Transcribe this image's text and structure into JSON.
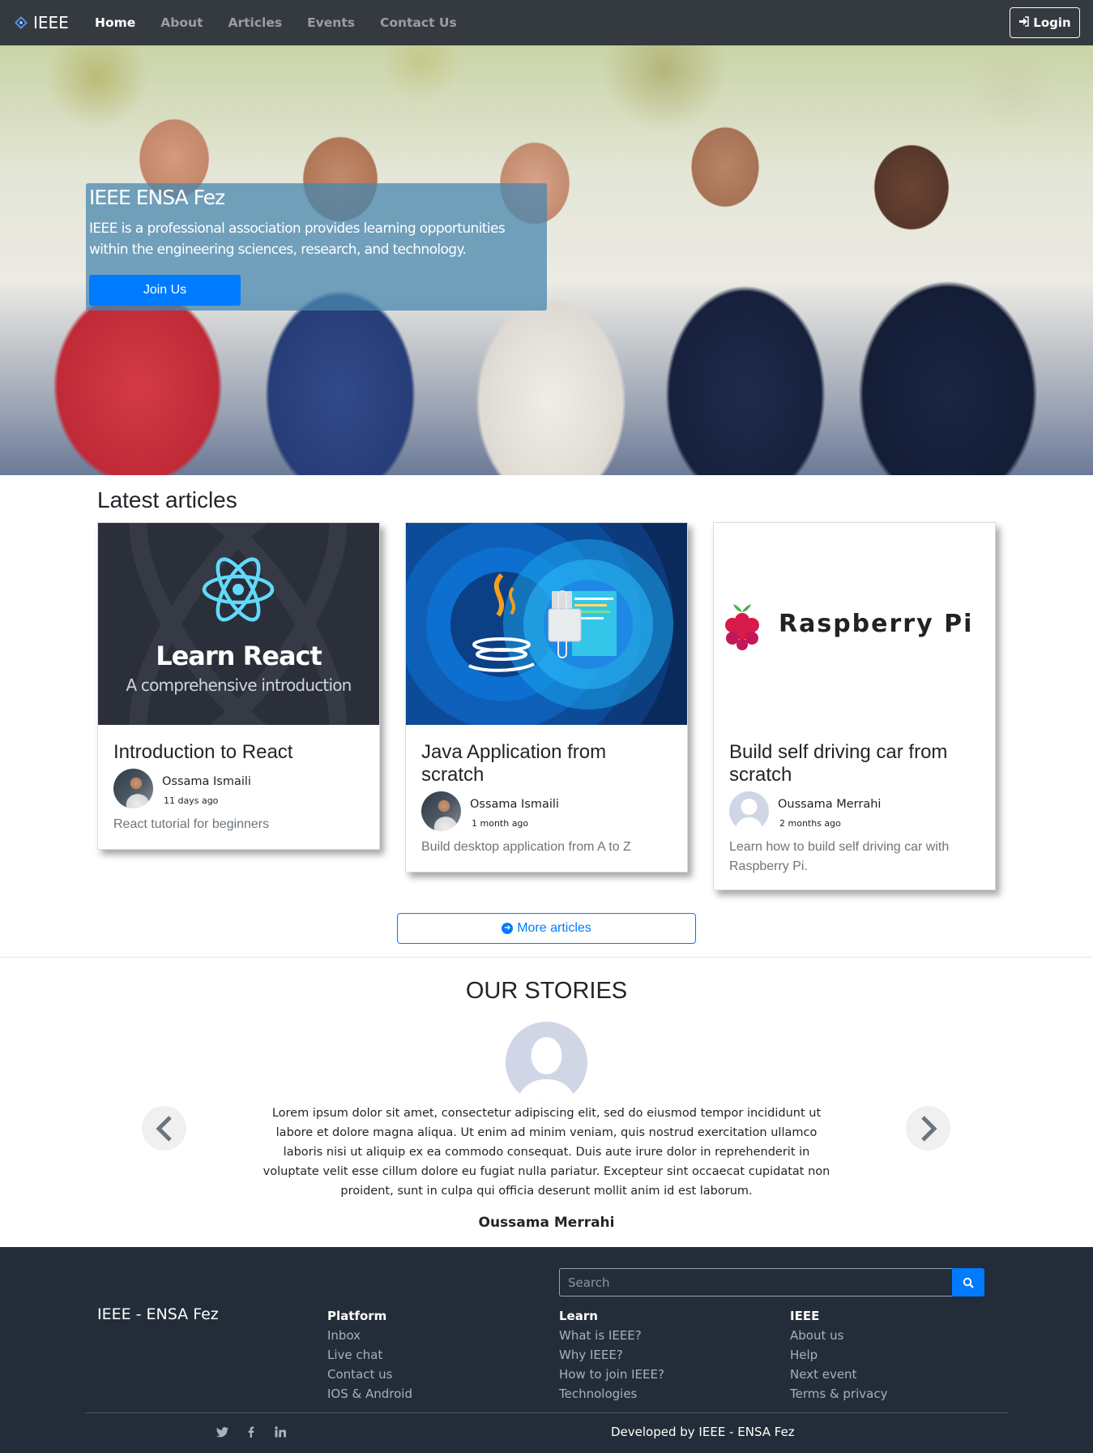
{
  "navbar": {
    "brand": "IEEE",
    "links": [
      "Home",
      "About",
      "Articles",
      "Events",
      "Contact Us"
    ],
    "login_label": "Login"
  },
  "hero": {
    "title": "IEEE ENSA Fez",
    "description": "IEEE is a professional association provides learning opportunities within the engineering sciences, research, and technology.",
    "button_label": "Join Us"
  },
  "articles": {
    "section_title": "Latest articles",
    "items": [
      {
        "image_title": "Learn React",
        "image_subtitle": "A comprehensive introduction",
        "title": "Introduction to React",
        "author": "Ossama Ismaili",
        "time": "11 days ago",
        "text": "React tutorial for beginners"
      },
      {
        "title": "Java Application from scratch",
        "author": "Ossama Ismaili",
        "time": "1 month ago",
        "text": "Build desktop application from A to Z"
      },
      {
        "image_title": "Raspberry Pi",
        "title": "Build self driving car from scratch",
        "author": "Oussama Merrahi",
        "time": "2 months ago",
        "text": "Learn how to build self driving car with Raspberry Pi."
      }
    ],
    "more_label": "More articles"
  },
  "stories": {
    "title": "OUR STORIES",
    "text": "Lorem ipsum dolor sit amet, consectetur adipiscing elit, sed do eiusmod tempor incididunt ut labore et dolore magna aliqua. Ut enim ad minim veniam, quis nostrud exercitation ullamco laboris nisi ut aliquip ex ea commodo consequat. Duis aute irure dolor in reprehenderit in voluptate velit esse cillum dolore eu fugiat nulla pariatur. Excepteur sint occaecat cupidatat non proident, sunt in culpa qui officia deserunt mollit anim id est laborum.",
    "name": "Oussama Merrahi"
  },
  "footer": {
    "search_placeholder": "Search",
    "brand": "IEEE - ENSA Fez",
    "columns": [
      {
        "heading": "Platform",
        "links": [
          "Inbox",
          "Live chat",
          "Contact us",
          "IOS & Android"
        ]
      },
      {
        "heading": "Learn",
        "links": [
          "What is IEEE?",
          "Why IEEE?",
          "How to join IEEE?",
          "Technologies"
        ]
      },
      {
        "heading": "IEEE",
        "links": [
          "About us",
          "Help",
          "Next event",
          "Terms & privacy"
        ]
      }
    ],
    "credit": "Developed by IEEE - ENSA Fez",
    "social_icons": [
      "twitter-icon",
      "facebook-icon",
      "linkedin-icon"
    ]
  },
  "colors": {
    "navbar_bg": "#343a40",
    "primary": "#007bff",
    "footer_bg": "#232d39"
  }
}
